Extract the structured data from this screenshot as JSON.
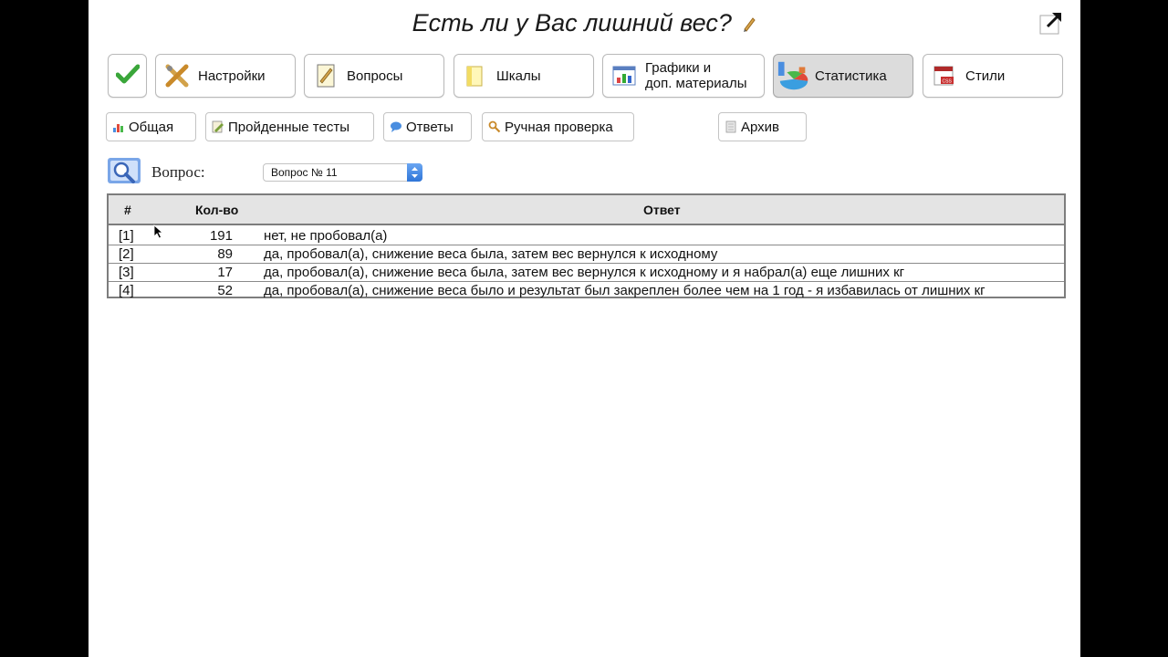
{
  "title": "Есть ли у Вас лишний вес?",
  "main_toolbar": [
    {
      "id": "check",
      "label": ""
    },
    {
      "id": "settings",
      "label": "Настройки"
    },
    {
      "id": "questions",
      "label": "Вопросы"
    },
    {
      "id": "scales",
      "label": "Шкалы"
    },
    {
      "id": "graphics",
      "label1": "Графики и",
      "label2": "доп. материалы"
    },
    {
      "id": "statistics",
      "label": "Статистика"
    },
    {
      "id": "styles",
      "label": "Стили"
    }
  ],
  "sub_toolbar": {
    "general": "Общая",
    "passed_tests": "Пройденные тесты",
    "answers": "Ответы",
    "manual_check": "Ручная проверка",
    "archive": "Архив"
  },
  "question_selector": {
    "label": "Вопрос:",
    "selected": "Вопрос № 11"
  },
  "table": {
    "headers": {
      "idx": "#",
      "count": "Кол-во",
      "answer": "Ответ"
    },
    "rows": [
      {
        "idx": "[1]",
        "count": "191",
        "answer": "нет, не пробовал(а)"
      },
      {
        "idx": "[2]",
        "count": "89",
        "answer": "да, пробовал(а), снижение веса была, затем вес вернулся к исходному"
      },
      {
        "idx": "[3]",
        "count": "17",
        "answer": "да, пробовал(а), снижение веса была, затем вес вернулся к исходному и я набрал(а) еще лишних кг"
      },
      {
        "idx": "[4]",
        "count": "52",
        "answer": "да, пробовал(а), снижение веса было и результат был закреплен более чем на 1 год - я избавилась от лишних кг"
      }
    ]
  },
  "colors": {
    "active_tab_bg": "#dcdcdc",
    "header_bg": "#e4e4e4",
    "select_arrow": "#2f75d8",
    "check_green": "#3aa63a"
  },
  "icons": [
    "pencil-icon",
    "popout-icon",
    "check-icon",
    "settings-icon",
    "questions-icon",
    "scales-icon",
    "charts-icon",
    "statistics-icon",
    "styles-icon",
    "search-icon"
  ]
}
